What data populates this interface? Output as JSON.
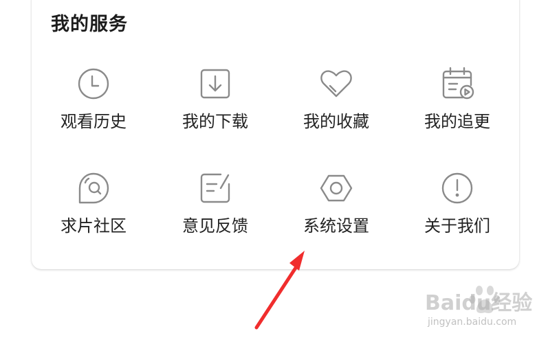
{
  "services": {
    "title": "我的服务",
    "items": [
      {
        "label": "观看历史",
        "icon": "clock-icon"
      },
      {
        "label": "我的下载",
        "icon": "download-icon"
      },
      {
        "label": "我的收藏",
        "icon": "heart-icon"
      },
      {
        "label": "我的追更",
        "icon": "calendar-play-icon"
      },
      {
        "label": "求片社区",
        "icon": "search-chat-icon"
      },
      {
        "label": "意见反馈",
        "icon": "feedback-edit-icon"
      },
      {
        "label": "系统设置",
        "icon": "hexagon-settings-icon"
      },
      {
        "label": "关于我们",
        "icon": "info-icon"
      }
    ]
  },
  "annotation": {
    "arrow_color": "#f02d2d"
  },
  "watermark": {
    "main": "Baidu经验",
    "sub": "jingyan.baidu.com"
  },
  "colors": {
    "icon_stroke": "#8a8a8a",
    "text": "#222222",
    "card_bg": "#ffffff"
  }
}
